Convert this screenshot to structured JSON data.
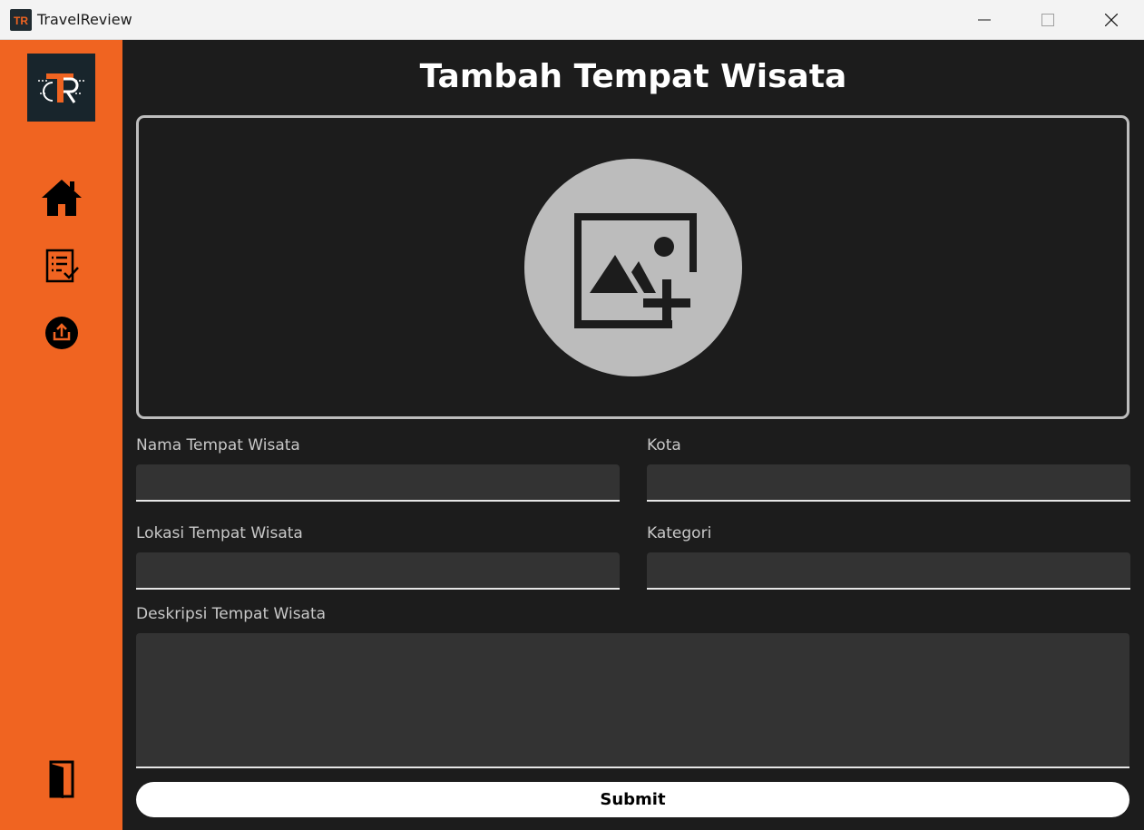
{
  "window": {
    "title": "TravelReview",
    "controls": [
      "minimize-icon",
      "maximize-icon",
      "close-icon"
    ]
  },
  "sidebar": {
    "logo_text": "TR",
    "items": [
      {
        "icon": "home-icon"
      },
      {
        "icon": "review-checklist-icon"
      },
      {
        "icon": "upload-icon"
      }
    ],
    "bottom_item": {
      "icon": "logout-door-icon"
    }
  },
  "colors": {
    "sidebar": "#f06421",
    "background": "#1c1c1c",
    "input_bg": "#333333",
    "accent_white": "#ffffff"
  },
  "main": {
    "title": "Tambah Tempat Wisata",
    "image_upload": {
      "icon": "add-image-icon"
    },
    "fields": {
      "nama": {
        "label": "Nama Tempat Wisata",
        "value": ""
      },
      "kota": {
        "label": "Kota",
        "value": ""
      },
      "lokasi": {
        "label": "Lokasi Tempat Wisata",
        "value": ""
      },
      "kategori": {
        "label": "Kategori",
        "value": ""
      },
      "deskripsi": {
        "label": "Deskripsi Tempat Wisata",
        "value": ""
      }
    },
    "submit_label": "Submit"
  }
}
